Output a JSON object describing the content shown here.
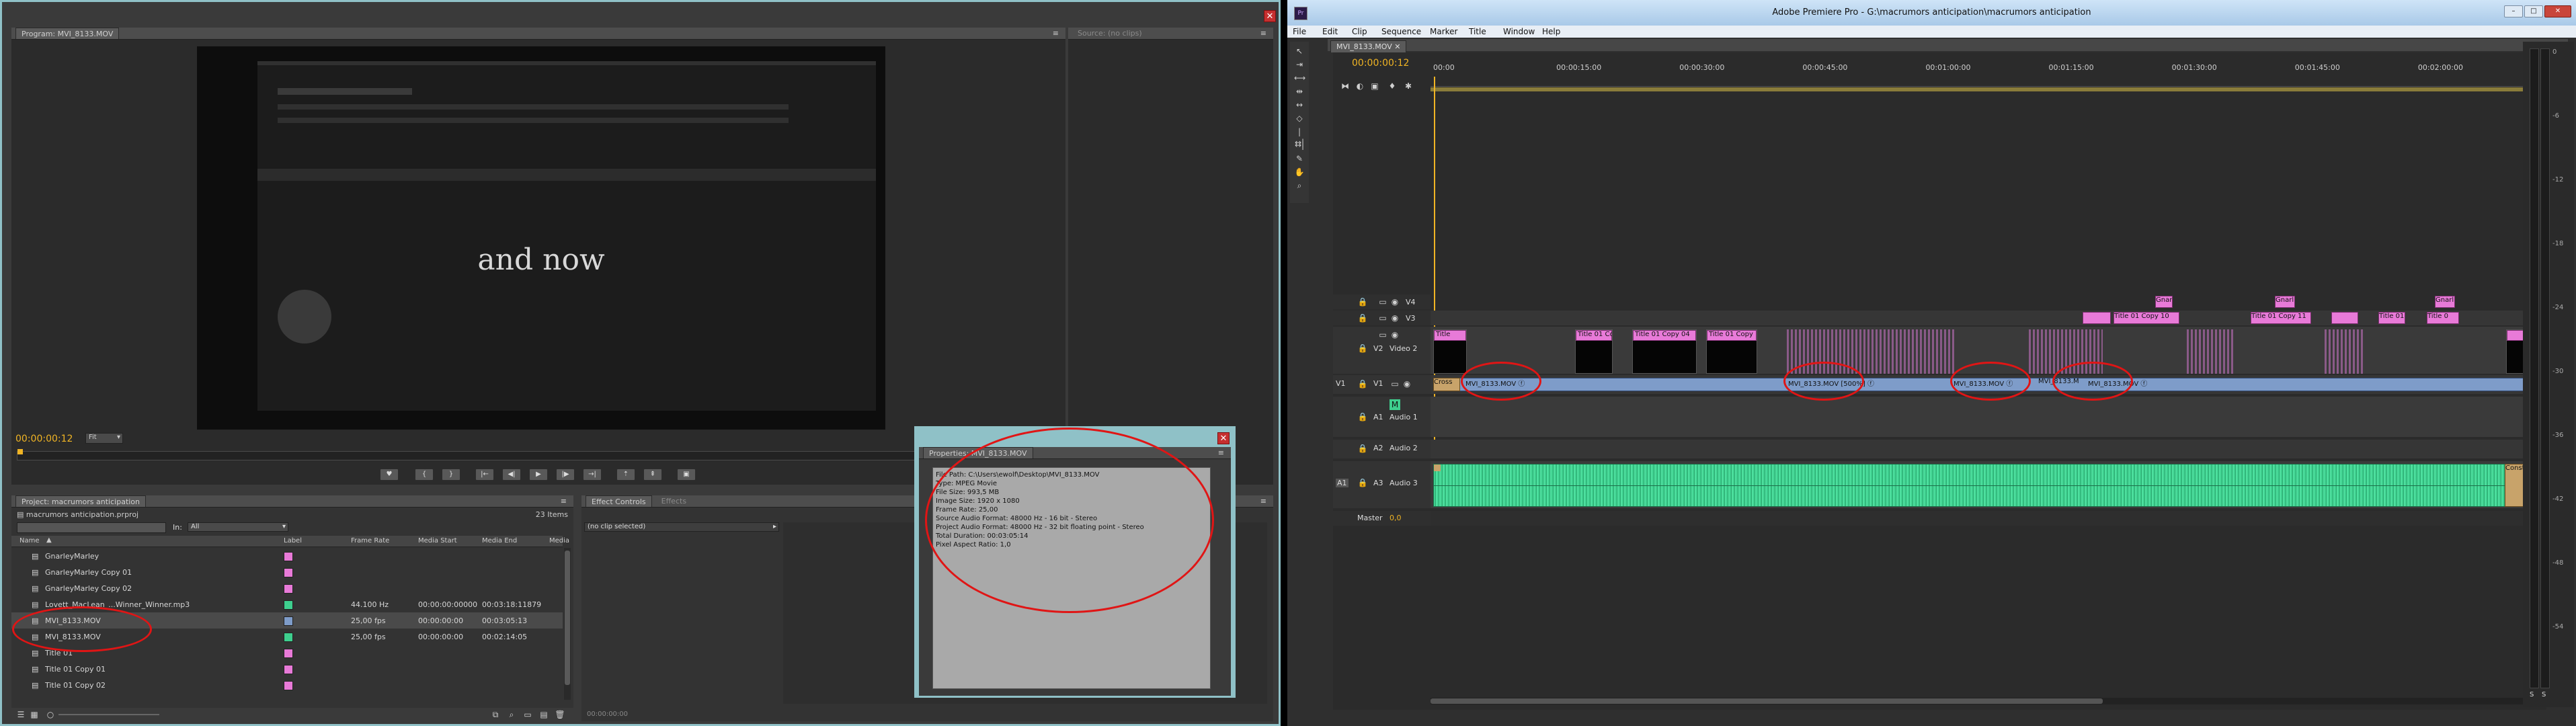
{
  "left_window": {
    "program_tab": "Program: MVI_8133.MOV",
    "source_tab": "Source: (no clips)",
    "video_caption": "and now",
    "timecode": "00:00:00:12",
    "zoom": "Fit",
    "project": {
      "tab": "Project: macrumors anticipation",
      "filename": "macrumors anticipation.prproj",
      "item_count": "23 Items",
      "in_label": "In:",
      "in_value": "All",
      "columns": [
        "Name",
        "Label",
        "Frame Rate",
        "Media Start",
        "Media End",
        "Media"
      ],
      "rows": [
        {
          "name": "GnarleyMarley",
          "color": "#e87ad8",
          "fps": "",
          "start": "",
          "end": ""
        },
        {
          "name": "GnarleyMarley Copy 01",
          "color": "#e87ad8",
          "fps": "",
          "start": "",
          "end": ""
        },
        {
          "name": "GnarleyMarley Copy 02",
          "color": "#e87ad8",
          "fps": "",
          "start": "",
          "end": ""
        },
        {
          "name": "Lovett_MacLean_...Winner_Winner.mp3",
          "color": "#3ecf8e",
          "fps": "44.100 Hz",
          "start": "00:00:00:00000",
          "end": "00:03:18:11879"
        },
        {
          "name": "MVI_8133.MOV",
          "color": "#7e9cc9",
          "fps": "25,00 fps",
          "start": "00:00:00:00",
          "end": "00:03:05:13"
        },
        {
          "name": "MVI_8133.MOV",
          "color": "#3ecf8e",
          "fps": "25,00 fps",
          "start": "00:00:00:00",
          "end": "00:02:14:05"
        },
        {
          "name": "Title 01",
          "color": "#e87ad8",
          "fps": "",
          "start": "",
          "end": ""
        },
        {
          "name": "Title 01 Copy 01",
          "color": "#e87ad8",
          "fps": "",
          "start": "",
          "end": ""
        },
        {
          "name": "Title 01 Copy 02",
          "color": "#e87ad8",
          "fps": "",
          "start": "",
          "end": ""
        }
      ]
    },
    "effects": {
      "tab_effect_controls": "Effect Controls",
      "tab_effects": "Effects",
      "no_clip": "(no clip selected)",
      "timecode": "00:00:00:00"
    },
    "properties": {
      "tab": "Properties: MVI_8133.MOV",
      "lines": [
        "File Path: C:\\Users\\ewolf\\Desktop\\MVI_8133.MOV",
        "Type: MPEG Movie",
        "File Size: 993,5 MB",
        "Image Size: 1920 x 1080",
        "Frame Rate: 25,00",
        "Source Audio Format: 48000 Hz - 16 bit - Stereo",
        "Project Audio Format: 48000 Hz - 32 bit floating point - Stereo",
        "Total Duration: 00:03:05:14",
        "Pixel Aspect Ratio: 1,0"
      ]
    }
  },
  "right_window": {
    "title": "Adobe Premiere Pro - G:\\macrumors anticipation\\macrumors anticipation",
    "menu": [
      "File",
      "Edit",
      "Clip",
      "Sequence",
      "Marker",
      "Title",
      "Window",
      "Help"
    ],
    "seq_tab": "MVI_8133.MOV",
    "timecode": "00:00:00:12",
    "ruler": [
      "00:00",
      "00:00:15:00",
      "00:00:30:00",
      "00:00:45:00",
      "00:01:00:00",
      "00:01:15:00",
      "00:01:30:00",
      "00:01:45:00",
      "00:02:00:00"
    ],
    "tracks": {
      "v4": "V4",
      "v3": "V3",
      "v2": "V2",
      "video2": "Video 2",
      "v1": "V1",
      "a1": "A1",
      "audio1": "Audio 1",
      "a2": "A2",
      "audio2": "Audio 2",
      "a3": "A3",
      "audio3": "Audio 3",
      "master": "Master",
      "master_val": "0,0"
    },
    "clips_v3": [
      "Gnarl",
      "Title 01 Copy 10",
      "Gnarl",
      "Title 01 Copy 11",
      "Title 01",
      "Gnarl",
      "Title 0"
    ],
    "clips_v2": [
      "Title",
      "Title 01 Co",
      "Title 01 Copy 04",
      "Title 01 Copy"
    ],
    "clips_v1": [
      "Cross",
      "MVI_8133.MOV",
      "MVI_8133.MOV [500%]",
      "MVI_8133.MOV",
      "MVI_8133.M",
      "MVI_8133.MOV"
    ],
    "audio_end_label": "Consta",
    "meter_scale": [
      "0",
      "-6",
      "-12",
      "-18",
      "-24",
      "-30",
      "-36",
      "-42",
      "-48",
      "-54"
    ],
    "meter_bottom": [
      "S",
      "S"
    ]
  },
  "colors": {
    "accent_timecode": "#f0b424",
    "clip_pink": "#e87ad8",
    "clip_blue": "#7e9cc9",
    "audio_green": "#3ecf8e",
    "annotation_red": "#e01515"
  }
}
